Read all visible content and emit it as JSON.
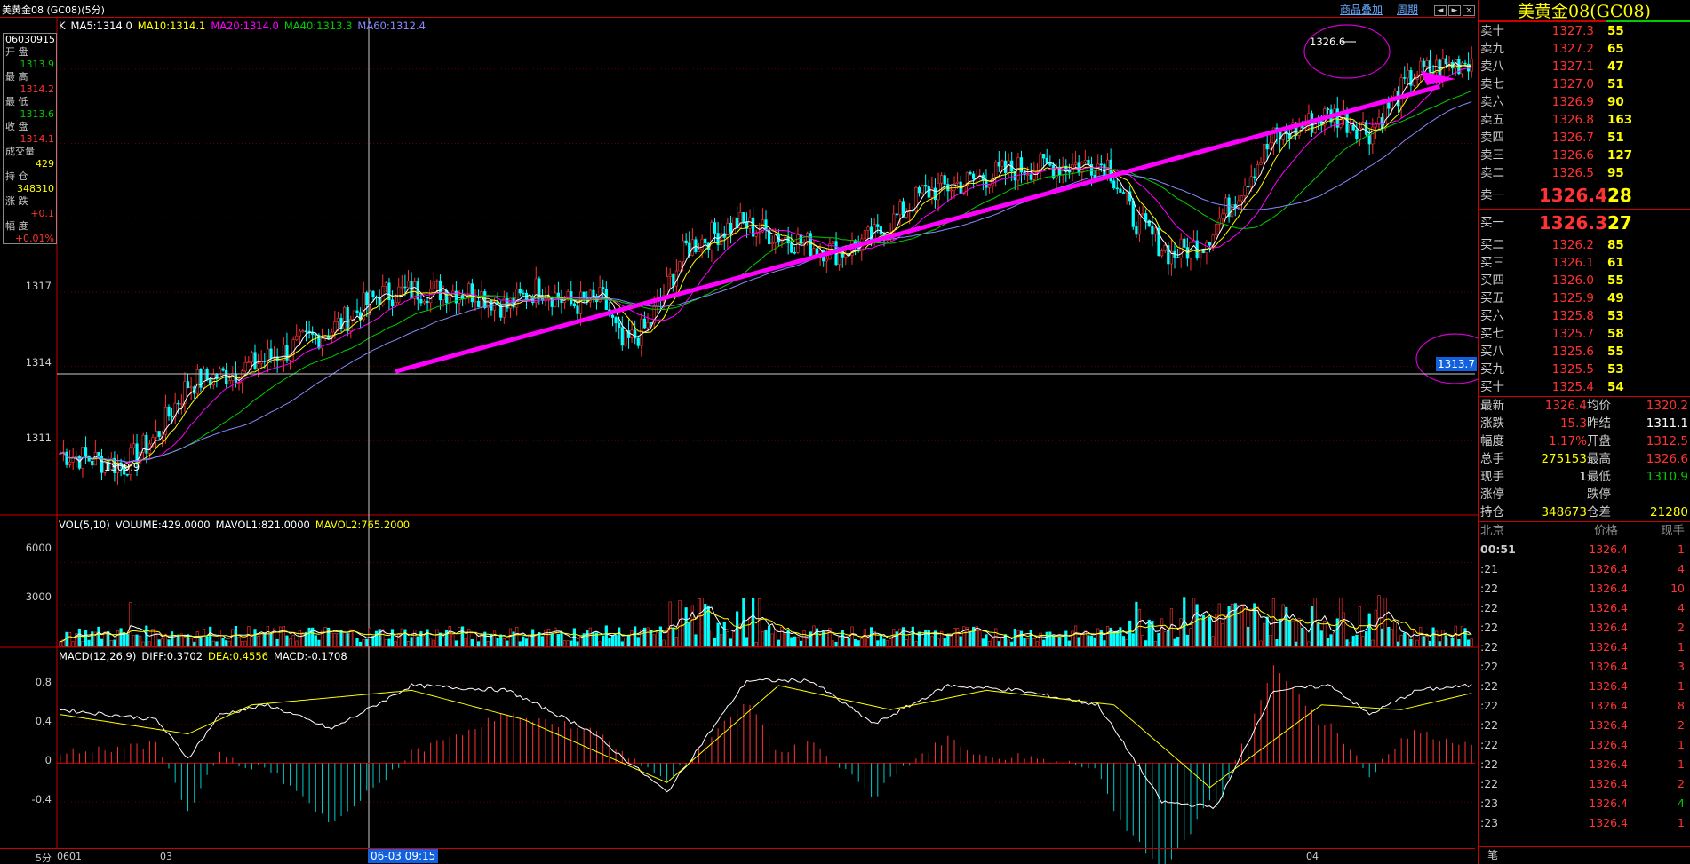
{
  "window": {
    "title": "美黄金08 (GC08)(5分)",
    "links": [
      "商品叠加",
      "周期"
    ],
    "ctrl_icons": [
      "prev-icon",
      "next-icon",
      "close-icon"
    ]
  },
  "main_legend": {
    "k": "K",
    "ma5": "MA5:1314.0",
    "ma10": "MA10:1314.1",
    "ma20": "MA20:1314.0",
    "ma40": "MA40:1313.3",
    "ma60": "MA60:1312.4"
  },
  "info": {
    "date": "06030915",
    "rows": [
      [
        "开 盘",
        "1313.9",
        "grn"
      ],
      [
        "最 高",
        "1314.2",
        "red"
      ],
      [
        "最 低",
        "1313.6",
        "grn"
      ],
      [
        "收 盘",
        "1314.1",
        "red"
      ],
      [
        "成交量",
        "429",
        "yel"
      ],
      [
        "持 仓",
        "348310",
        "yel"
      ],
      [
        "涨 跌",
        "+0.1",
        "red"
      ],
      [
        "幅 度",
        "+0.01%",
        "red"
      ]
    ]
  },
  "yaxis_main": [
    "1317",
    "1314",
    "1311"
  ],
  "annotations": {
    "high": "1326.6",
    "low": "1309.9",
    "price_tag": "1313.7"
  },
  "vol_legend": {
    "vol": "VOL(5,10)",
    "volume": "VOLUME:429.0000",
    "mavol1": "MAVOL1:821.0000",
    "mavol2": "MAVOL2:765.2000"
  },
  "yaxis_vol": [
    "6000",
    "3000"
  ],
  "macd_legend": {
    "macd": "MACD(12,26,9)",
    "diff": "DIFF:0.3702",
    "dea": "DEA:0.4556",
    "val": "MACD:-0.1708"
  },
  "yaxis_macd": [
    "0.8",
    "0.4",
    "0",
    "-0.4"
  ],
  "xaxis": {
    "period": "5分",
    "labels": [
      "0601",
      "03",
      "04"
    ],
    "cursor_time": "06-03 09:15"
  },
  "quote": {
    "title": "美黄金08(GC08)",
    "asks": [
      [
        "卖十",
        "1327.3",
        "55"
      ],
      [
        "卖九",
        "1327.2",
        "65"
      ],
      [
        "卖八",
        "1327.1",
        "47"
      ],
      [
        "卖七",
        "1327.0",
        "51"
      ],
      [
        "卖六",
        "1326.9",
        "90"
      ],
      [
        "卖五",
        "1326.8",
        "163"
      ],
      [
        "卖四",
        "1326.7",
        "51"
      ],
      [
        "卖三",
        "1326.6",
        "127"
      ],
      [
        "卖二",
        "1326.5",
        "95"
      ]
    ],
    "ask1": [
      "卖一",
      "1326.4",
      "28"
    ],
    "bid1": [
      "买一",
      "1326.3",
      "27"
    ],
    "bids": [
      [
        "买二",
        "1326.2",
        "85"
      ],
      [
        "买三",
        "1326.1",
        "61"
      ],
      [
        "买四",
        "1326.0",
        "55"
      ],
      [
        "买五",
        "1325.9",
        "49"
      ],
      [
        "买六",
        "1325.8",
        "53"
      ],
      [
        "买七",
        "1325.7",
        "58"
      ],
      [
        "买八",
        "1325.6",
        "55"
      ],
      [
        "买九",
        "1325.5",
        "53"
      ],
      [
        "买十",
        "1325.4",
        "54"
      ]
    ],
    "stats": [
      [
        "最新",
        "1326.4",
        "red",
        "均价",
        "1320.2",
        "red"
      ],
      [
        "涨跌",
        "15.3",
        "red",
        "昨结",
        "1311.1",
        "wht"
      ],
      [
        "幅度",
        "1.17%",
        "red",
        "开盘",
        "1312.5",
        "red"
      ],
      [
        "总手",
        "275153",
        "yel",
        "最高",
        "1326.6",
        "red"
      ],
      [
        "现手",
        "1",
        "wht",
        "最低",
        "1310.9",
        "grn"
      ],
      [
        "涨停",
        "—",
        "wht",
        "跌停",
        "—",
        "wht"
      ],
      [
        "持仓",
        "348673",
        "yel",
        "仓差",
        "21280",
        "yel"
      ]
    ],
    "ticks_header": [
      "北京",
      "价格",
      "现手"
    ],
    "ticks": [
      [
        "00:51",
        "1326.4",
        "1",
        "red"
      ],
      [
        ":21",
        "1326.4",
        "4",
        "red"
      ],
      [
        ":22",
        "1326.4",
        "10",
        "red"
      ],
      [
        ":22",
        "1326.4",
        "4",
        "red"
      ],
      [
        ":22",
        "1326.4",
        "2",
        "red"
      ],
      [
        ":22",
        "1326.4",
        "1",
        "red"
      ],
      [
        ":22",
        "1326.4",
        "3",
        "red"
      ],
      [
        ":22",
        "1326.4",
        "1",
        "red"
      ],
      [
        ":22",
        "1326.4",
        "8",
        "red"
      ],
      [
        ":22",
        "1326.4",
        "2",
        "red"
      ],
      [
        ":22",
        "1326.4",
        "1",
        "red"
      ],
      [
        ":22",
        "1326.4",
        "1",
        "red"
      ],
      [
        ":22",
        "1326.4",
        "2",
        "red"
      ],
      [
        ":23",
        "1326.4",
        "4",
        "grn"
      ],
      [
        ":23",
        "1326.4",
        "1",
        "red"
      ]
    ],
    "footer": "笔"
  },
  "chart_data": {
    "type": "candlestick",
    "anchors_price": [
      [
        0,
        1310.5
      ],
      [
        20,
        1310.0
      ],
      [
        30,
        1311.2
      ],
      [
        40,
        1313.3
      ],
      [
        55,
        1313.8
      ],
      [
        70,
        1314.6
      ],
      [
        85,
        1315.5
      ],
      [
        100,
        1316.9
      ],
      [
        115,
        1317.1
      ],
      [
        130,
        1317.0
      ],
      [
        140,
        1316.4
      ],
      [
        150,
        1317.2
      ],
      [
        160,
        1316.5
      ],
      [
        170,
        1316.7
      ],
      [
        176,
        1314.8
      ],
      [
        184,
        1315.6
      ],
      [
        196,
        1318.8
      ],
      [
        212,
        1319.8
      ],
      [
        232,
        1319.0
      ],
      [
        244,
        1318.6
      ],
      [
        256,
        1319.3
      ],
      [
        270,
        1321.0
      ],
      [
        300,
        1322.0
      ],
      [
        328,
        1322.2
      ],
      [
        336,
        1320.0
      ],
      [
        348,
        1318.5
      ],
      [
        358,
        1319.0
      ],
      [
        366,
        1320.5
      ],
      [
        380,
        1323.2
      ],
      [
        398,
        1324.2
      ],
      [
        410,
        1323.5
      ],
      [
        424,
        1325.8
      ],
      [
        442,
        1326.4
      ]
    ],
    "ylim": [
      1308,
      1328
    ],
    "vol_ylim": [
      0,
      8000
    ],
    "macd_ylim": [
      -0.6,
      1.0
    ],
    "macd_anchors": [
      [
        0,
        0.55
      ],
      [
        30,
        0.45
      ],
      [
        40,
        0.05
      ],
      [
        50,
        0.5
      ],
      [
        65,
        0.6
      ],
      [
        85,
        0.35
      ],
      [
        110,
        0.8
      ],
      [
        140,
        0.75
      ],
      [
        165,
        0.35
      ],
      [
        190,
        -0.3
      ],
      [
        215,
        0.85
      ],
      [
        235,
        0.85
      ],
      [
        255,
        0.4
      ],
      [
        278,
        0.8
      ],
      [
        300,
        0.75
      ],
      [
        325,
        0.6
      ],
      [
        345,
        -0.4
      ],
      [
        362,
        -0.45
      ],
      [
        380,
        0.75
      ],
      [
        398,
        0.8
      ],
      [
        410,
        0.5
      ],
      [
        425,
        0.75
      ],
      [
        442,
        0.8
      ]
    ],
    "dea_anchors": [
      [
        0,
        0.5
      ],
      [
        40,
        0.3
      ],
      [
        60,
        0.6
      ],
      [
        110,
        0.75
      ],
      [
        145,
        0.45
      ],
      [
        190,
        -0.2
      ],
      [
        225,
        0.8
      ],
      [
        260,
        0.55
      ],
      [
        290,
        0.75
      ],
      [
        330,
        0.6
      ],
      [
        360,
        -0.25
      ],
      [
        395,
        0.6
      ],
      [
        420,
        0.55
      ],
      [
        442,
        0.72
      ]
    ]
  }
}
